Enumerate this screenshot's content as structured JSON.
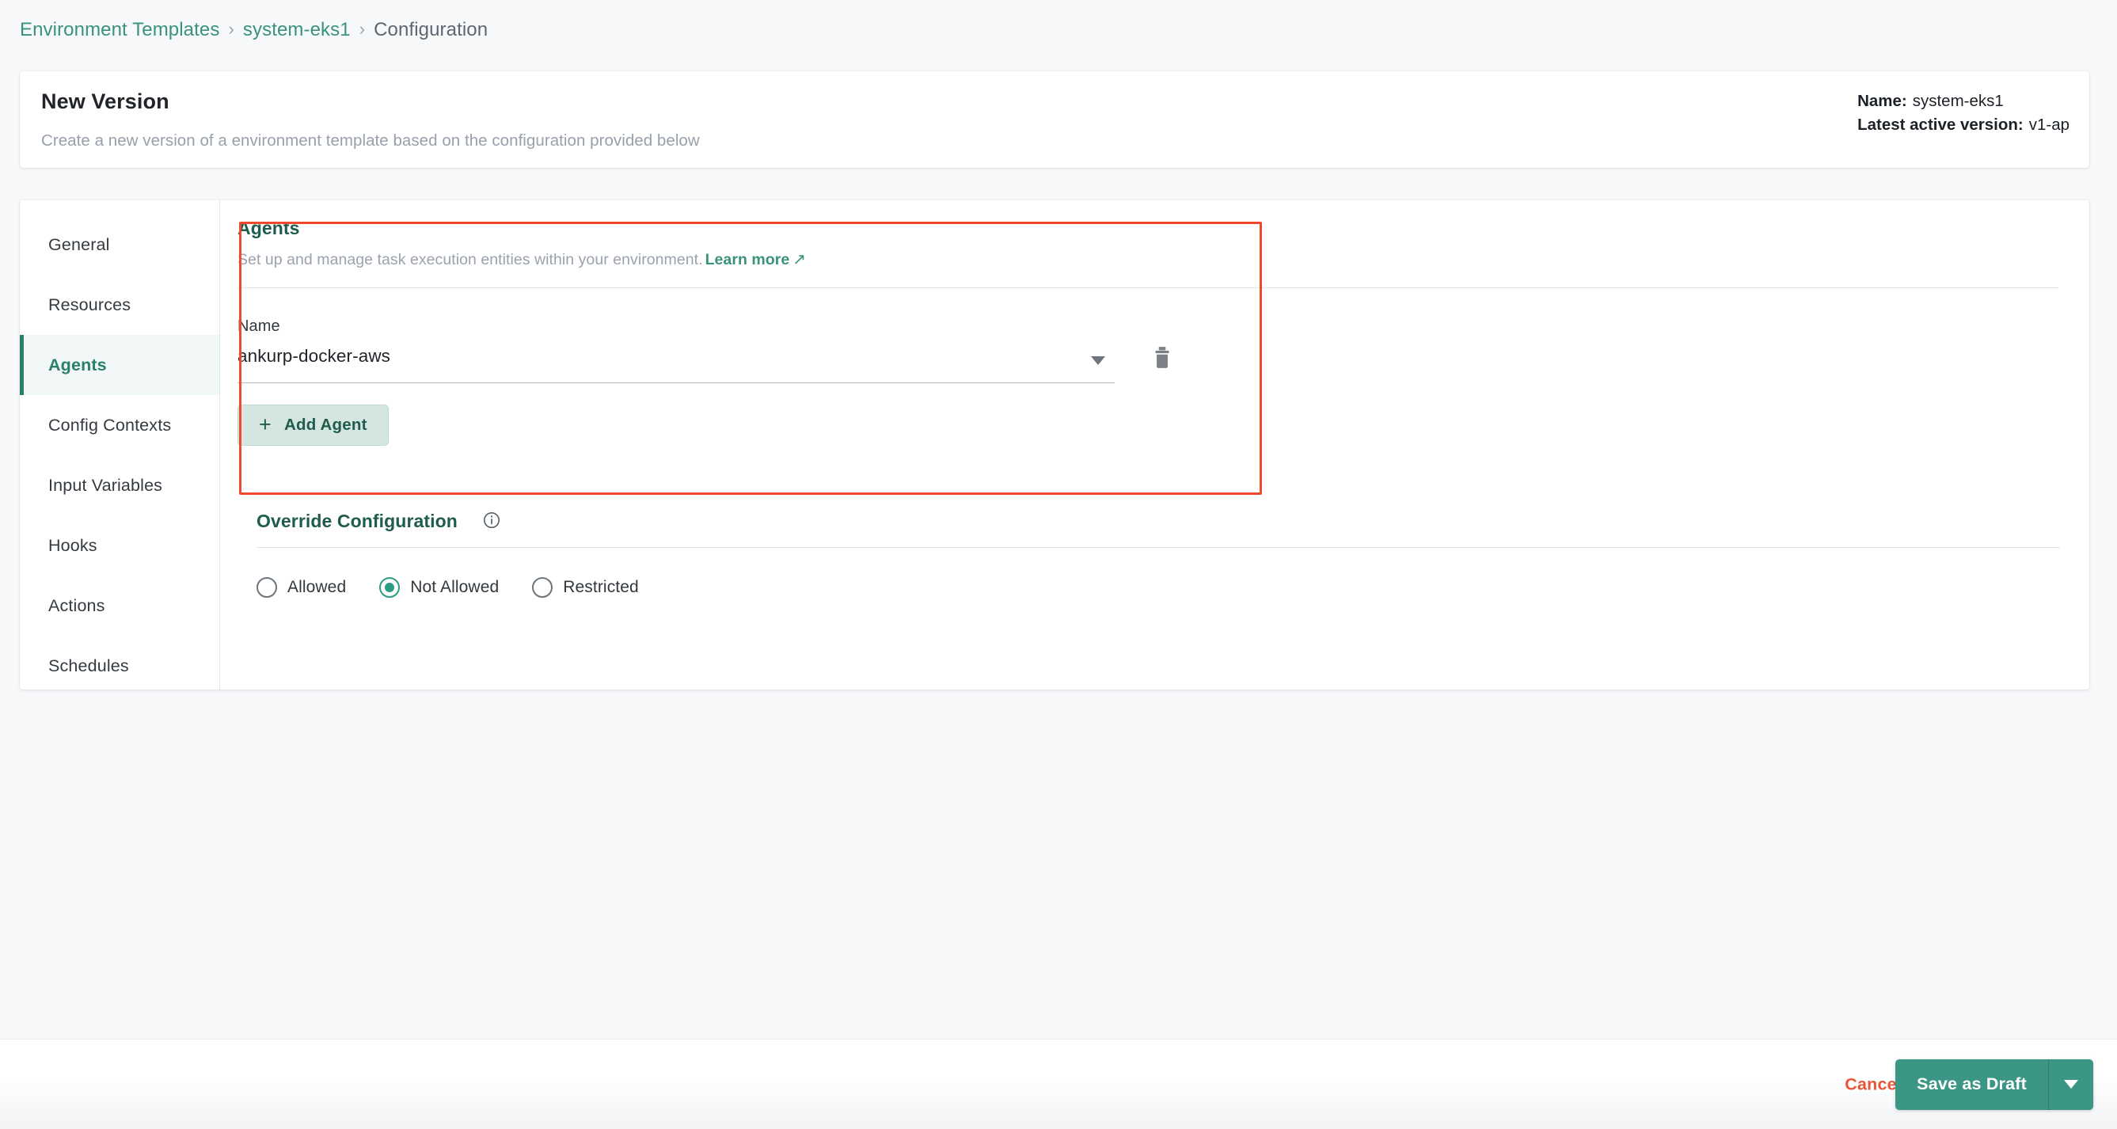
{
  "breadcrumb": {
    "items": [
      {
        "label": "Environment Templates",
        "type": "link"
      },
      {
        "label": "system-eks1",
        "type": "link"
      },
      {
        "label": "Configuration",
        "type": "current"
      }
    ],
    "separator": "›"
  },
  "header": {
    "title": "New Version",
    "subtitle": "Create a new version of a environment template based on the configuration provided below",
    "meta": {
      "name_key": "Name:",
      "name_value": "system-eks1",
      "version_key": "Latest active version:",
      "version_value": "v1-ap"
    }
  },
  "sidebar": {
    "items": [
      {
        "label": "General",
        "active": false
      },
      {
        "label": "Resources",
        "active": false
      },
      {
        "label": "Agents",
        "active": true
      },
      {
        "label": "Config Contexts",
        "active": false
      },
      {
        "label": "Input Variables",
        "active": false
      },
      {
        "label": "Hooks",
        "active": false
      },
      {
        "label": "Actions",
        "active": false
      },
      {
        "label": "Schedules",
        "active": false
      }
    ]
  },
  "agents": {
    "title": "Agents",
    "description": "Set up and manage task execution entities within your environment.",
    "learn_more": "Learn more",
    "learn_more_arrow": "↗",
    "name_label": "Name",
    "name_value": "ankurp-docker-aws",
    "add_button": "Add Agent",
    "add_button_icon": "+",
    "delete_icon": "trash-icon",
    "highlight_color": "#ef4a2c"
  },
  "override": {
    "title": "Override Configuration",
    "info_icon": "info-icon",
    "options": [
      {
        "label": "Allowed",
        "selected": false
      },
      {
        "label": "Not Allowed",
        "selected": true
      },
      {
        "label": "Restricted",
        "selected": false
      }
    ],
    "selected_color": "#2a9d82"
  },
  "footer": {
    "cancel": "Cancel",
    "save": "Save as Draft",
    "save_color": "#3b9685",
    "cancel_color": "#e8563a"
  }
}
